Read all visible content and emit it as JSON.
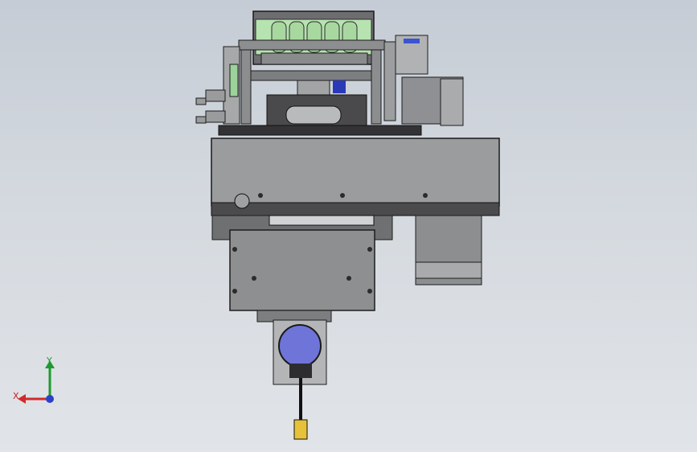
{
  "viewport": {
    "background_top": "#c5ccd5",
    "background_bottom": "#e1e4e8"
  },
  "colors": {
    "steel": "#9a9b9d",
    "steel_dark": "#3a3a3c",
    "gripper": "#b7e3b0",
    "motor_blue": "#6f74d8",
    "connector_yellow": "#e6c23a"
  },
  "triad": {
    "x_label": "X",
    "y_label": "Y",
    "x_color": "#d22a2a",
    "y_color": "#1f9a2e",
    "z_color": "#2b42c8"
  }
}
